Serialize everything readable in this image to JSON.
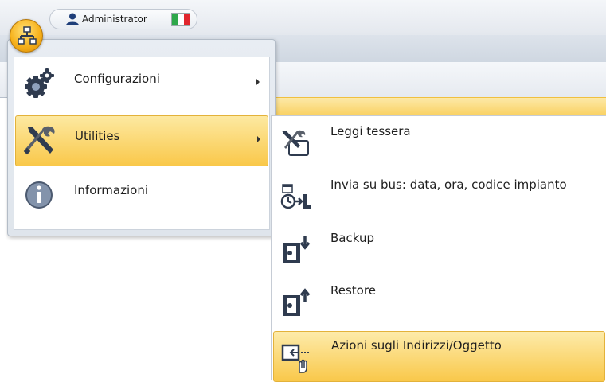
{
  "header": {
    "user_name": "Administrator",
    "flag_colors": [
      "#2ea84a",
      "#ffffff",
      "#e0262d"
    ]
  },
  "app_button": {
    "icon": "network-icon"
  },
  "main_menu": {
    "items": [
      {
        "label": "Configurazioni",
        "icon": "gears-icon",
        "has_submenu": true,
        "active": false
      },
      {
        "label": "Utilities",
        "icon": "tools-icon",
        "has_submenu": true,
        "active": true
      },
      {
        "label": "Informazioni",
        "icon": "info-icon",
        "has_submenu": false,
        "active": false
      }
    ]
  },
  "submenu": {
    "items": [
      {
        "label": "Leggi tessera",
        "icon": "read-card-icon",
        "active": false
      },
      {
        "label": "Invia su bus: data, ora, codice impianto",
        "icon": "send-bus-icon",
        "active": false
      },
      {
        "label": "Backup",
        "icon": "backup-icon",
        "active": false
      },
      {
        "label": "Restore",
        "icon": "restore-icon",
        "active": false
      },
      {
        "label": "Azioni sugli Indirizzi/Oggetto",
        "icon": "address-actions-icon",
        "active": true
      }
    ]
  },
  "colors": {
    "highlight": "#f9c84a",
    "app_button": "#f7b21c"
  }
}
